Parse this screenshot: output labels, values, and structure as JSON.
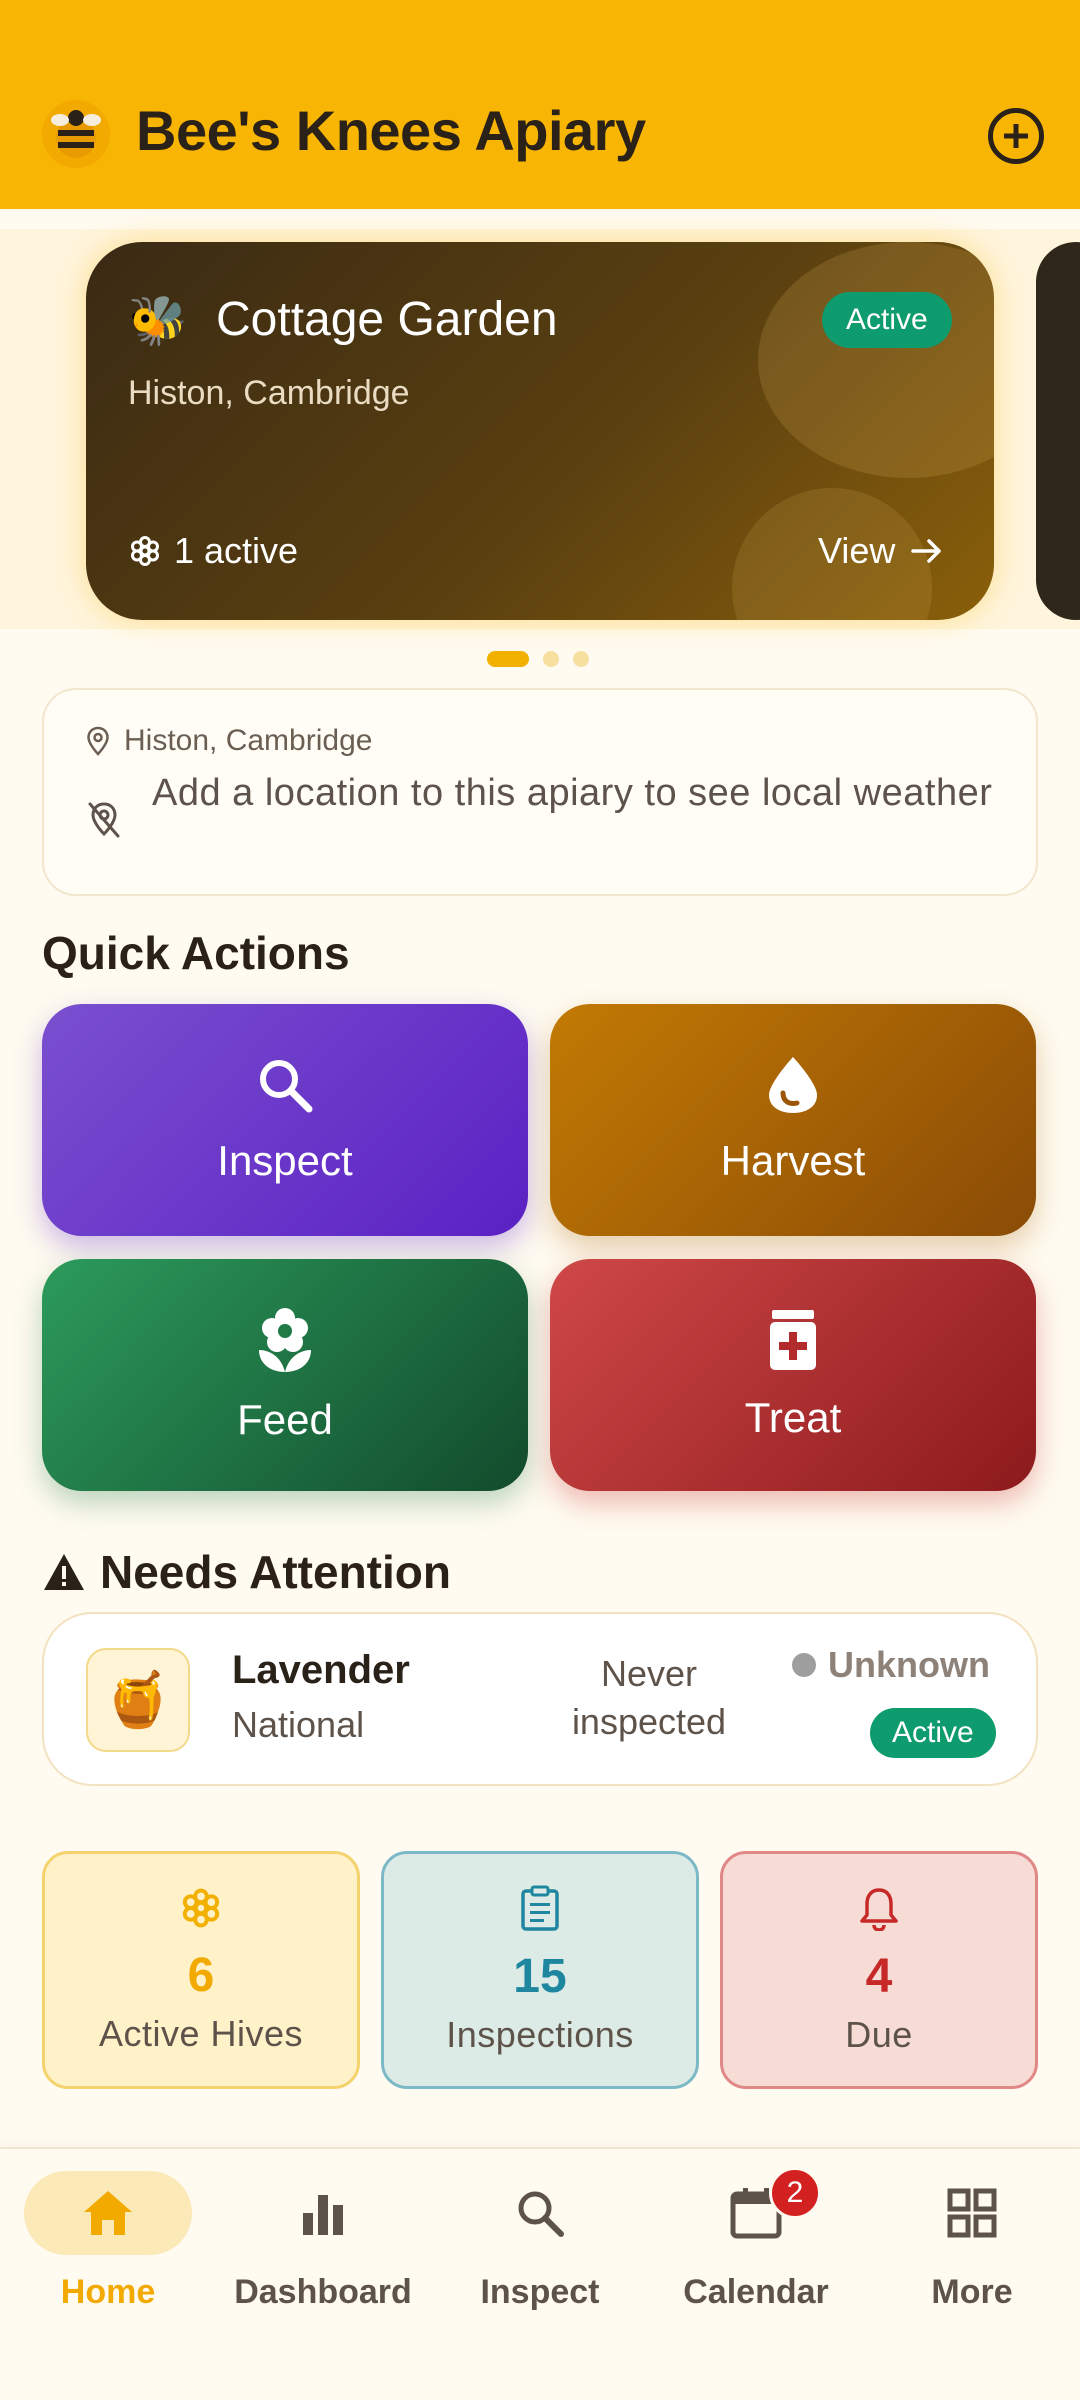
{
  "app": {
    "title": "Bee's Knees Apiary"
  },
  "apiary_card": {
    "name": "Cottage Garden",
    "location": "Histon, Cambridge",
    "status": "Active",
    "hive_count": "1 active",
    "view_label": "View"
  },
  "carousel": {
    "page": 1,
    "pages": 3
  },
  "weather": {
    "location": "Histon, Cambridge",
    "message": "Add a location to this apiary to see local weather"
  },
  "quick_actions": {
    "title": "Quick Actions",
    "inspect": "Inspect",
    "harvest": "Harvest",
    "feed": "Feed",
    "treat": "Treat"
  },
  "attention": {
    "title": "Needs Attention",
    "hive_name": "Lavender",
    "hive_type": "National",
    "last_inspection": "Never inspected",
    "health": "Unknown",
    "status": "Active"
  },
  "stats": {
    "hives_value": "6",
    "hives_label": "Active Hives",
    "inspections_value": "15",
    "inspections_label": "Inspections",
    "due_value": "4",
    "due_label": "Due"
  },
  "nav": {
    "home": "Home",
    "dashboard": "Dashboard",
    "inspect": "Inspect",
    "calendar": "Calendar",
    "calendar_badge": "2",
    "more": "More"
  },
  "colors": {
    "primary": "#f8b503",
    "active_green": "#0e9b6e",
    "inspect": "#6a37cc",
    "harvest": "#a8640a",
    "feed": "#1f7a44",
    "treat": "#b22c2e"
  }
}
